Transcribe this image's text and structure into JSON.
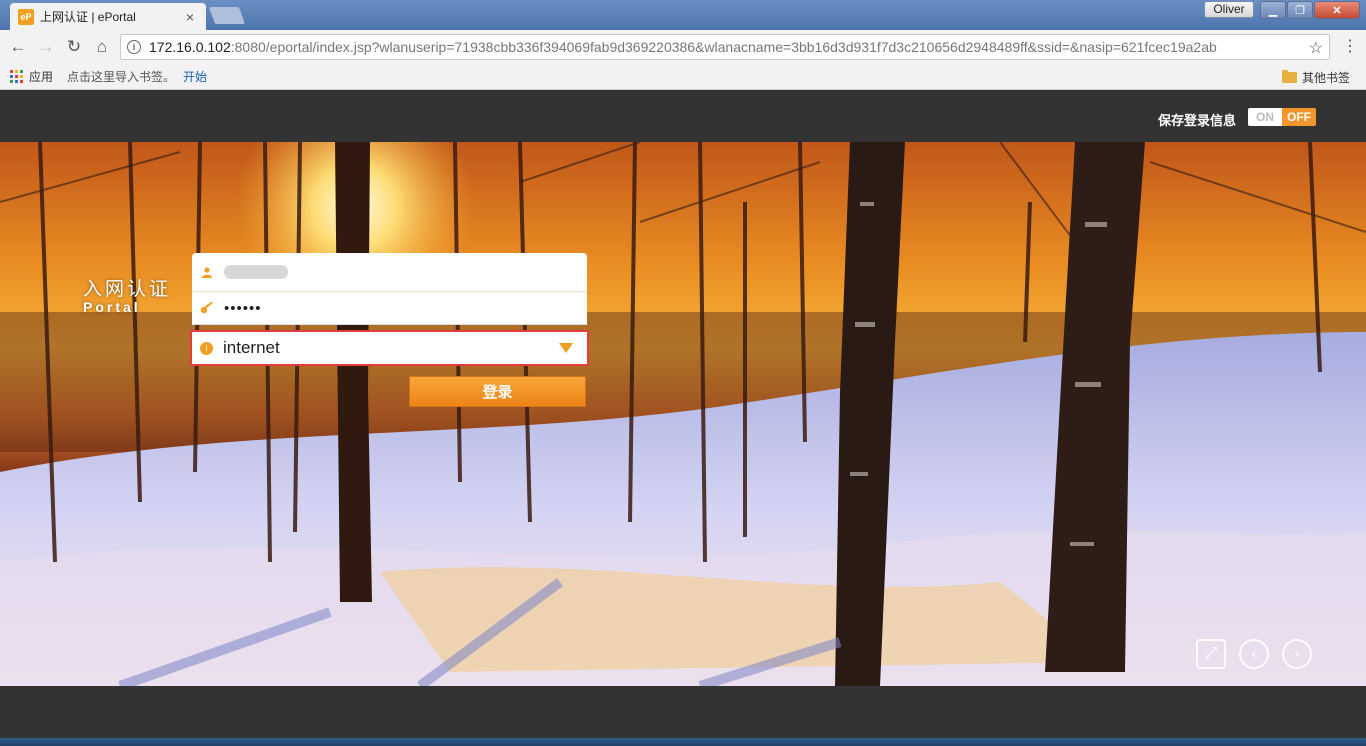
{
  "browser": {
    "tab_title": "上网认证 | ePortal",
    "tab_icon_text": "eP",
    "user_name": "Oliver",
    "url_host": "172.16.0.102",
    "url_rest": ":8080/eportal/index.jsp?wlanuserip=71938cbb336f394069fab9d369220386&wlanacname=3bb16d3d931f7d3c210656d2948489ff&ssid=&nasip=621fcec19a2ab",
    "bookmarks": {
      "apps_label": "应用",
      "hint": "点击这里导入书签。",
      "start_label": "开始",
      "other_label": "其他书签"
    }
  },
  "header": {
    "save_login_label": "保存登录信息",
    "toggle_on_label": "ON",
    "toggle_off_label": "OFF"
  },
  "login": {
    "brand_cn": "入网认证",
    "brand_en": "Portal",
    "password_mask": "••••••",
    "service_value": "internet",
    "login_button_label": "登录"
  },
  "colors": {
    "accent": "#f0a020",
    "highlight_border": "#e33c3c"
  }
}
